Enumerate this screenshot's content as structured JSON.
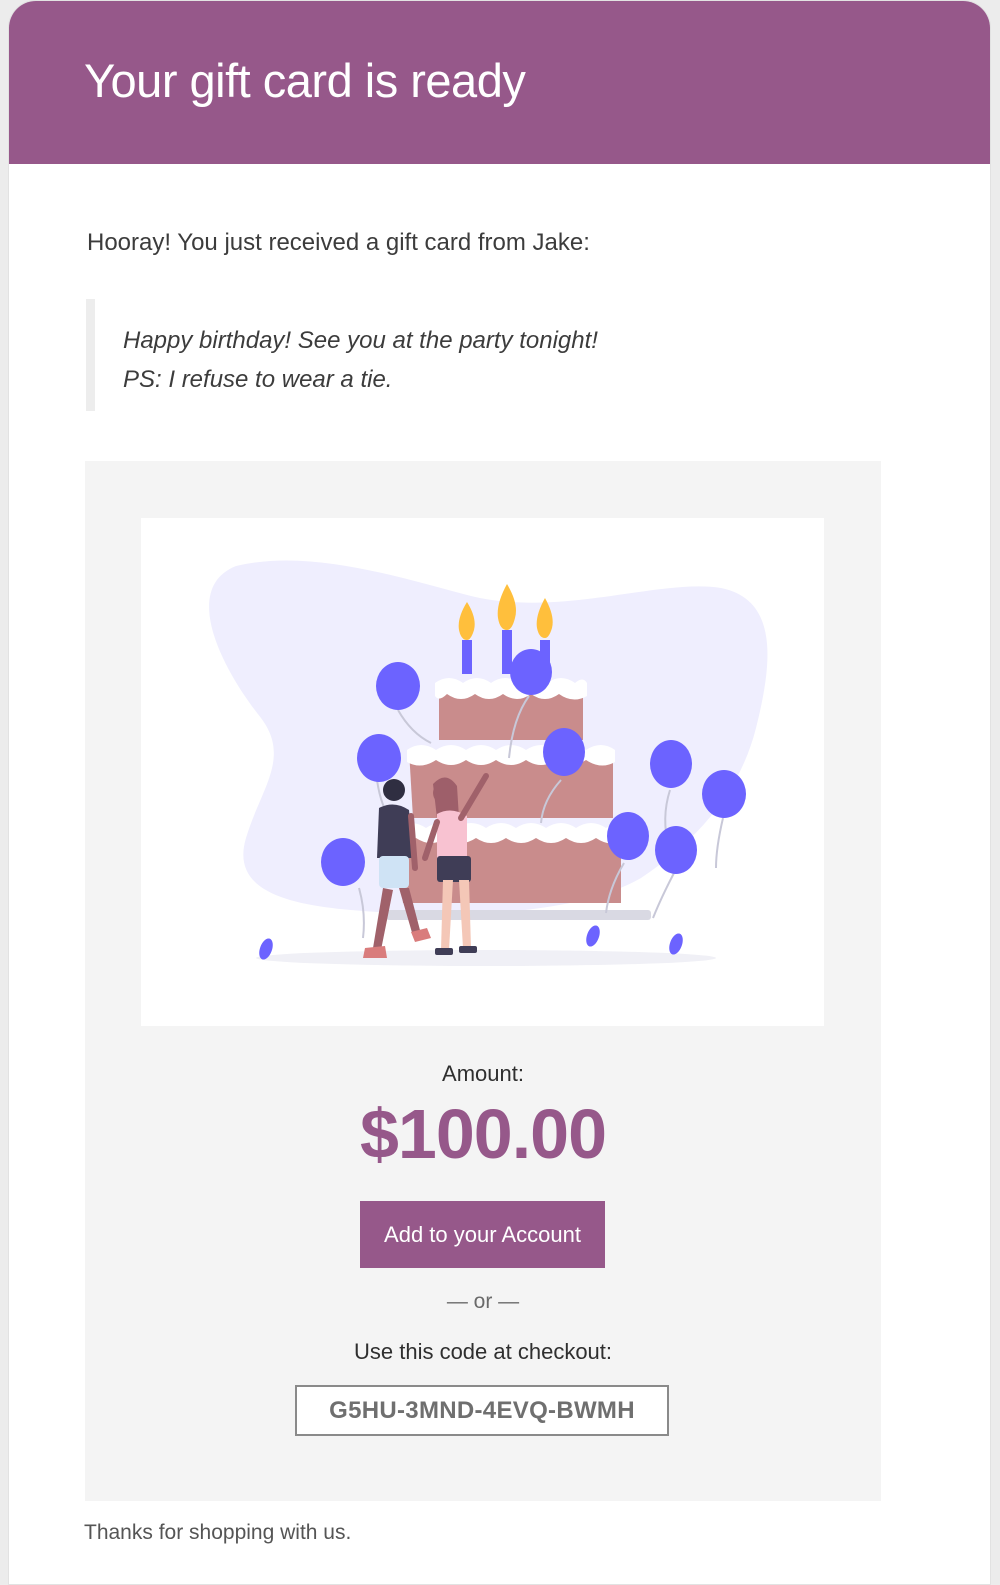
{
  "header": {
    "title": "Your gift card is ready"
  },
  "message": {
    "intro": "Hooray! You just received a gift card from Jake:",
    "quote_line_1": "Happy birthday! See you at the party tonight!",
    "quote_line_2": "PS: I refuse to wear a tie."
  },
  "card": {
    "image_subject": "birthday-cake-illustration",
    "amount_label": "Amount:",
    "amount_value": "$100.00",
    "redeem_button": "Add to your Account",
    "separator": "— or —",
    "code_label": "Use this code at checkout:",
    "code": "G5HU-3MND-4EVQ-BWMH"
  },
  "footer": {
    "text": "Thanks for shopping with us."
  },
  "colors": {
    "brand": "#96588a",
    "card_background": "#f4f4f4",
    "balloon": "#6c63ff",
    "cake": "#c98c8c"
  }
}
